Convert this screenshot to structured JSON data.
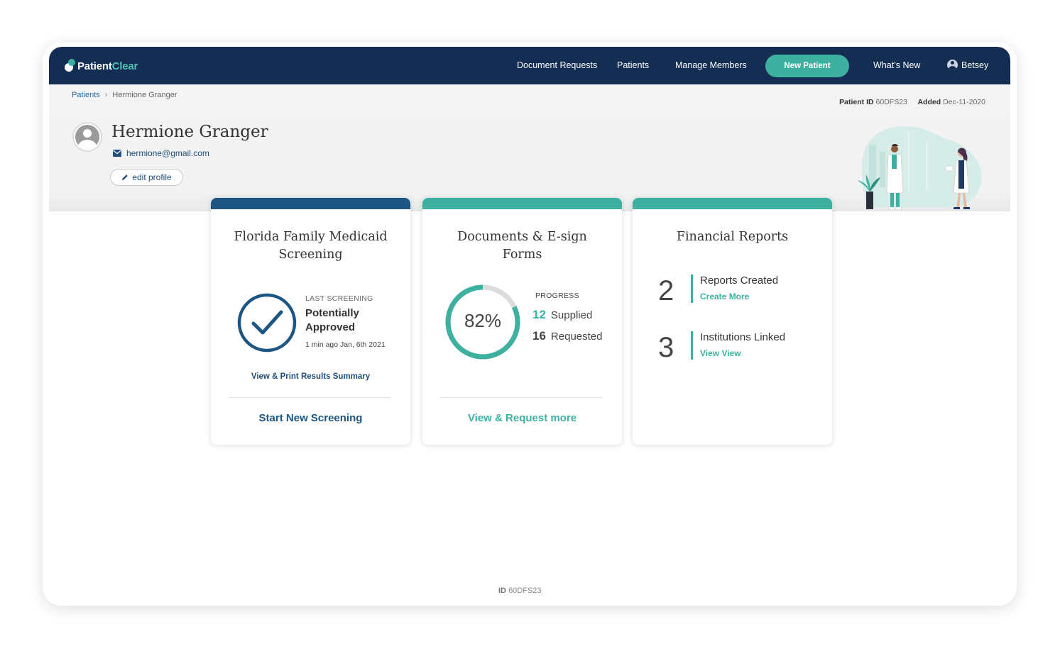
{
  "brand": {
    "name_part1": "Patient",
    "name_part2": "Clear"
  },
  "nav": {
    "links": [
      "Document Requests",
      "Patients",
      "Manage Members"
    ],
    "primary_button": "New Patient",
    "whats_new": "What’s New",
    "user_name": "Betsey"
  },
  "breadcrumb": {
    "parent": "Patients",
    "separator": ">",
    "current": "Hermione Granger"
  },
  "patient": {
    "id_label": "Patient ID",
    "id_value": "60DFS23",
    "added_label": "Added",
    "added_value": "Dec-11-2020",
    "name": "Hermione Granger",
    "email": "hermione@gmail.com",
    "edit_label": "edit profile"
  },
  "cards": {
    "screening": {
      "title": "Florida Family Medicaid Screening",
      "last_label": "LAST SCREENING",
      "status": "Potentially Approved",
      "time": "1 min ago Jan, 6th 2021",
      "print_link": "View  & Print Results Summary",
      "cta": "Start New Screening",
      "accent": "#1d5683"
    },
    "documents": {
      "title": "Documents & E-sign Forms",
      "progress_label": "PROGRESS",
      "percent_text": "82%",
      "percent_value": 82,
      "supplied_count": "12",
      "supplied_label": "Supplied",
      "requested_count": "16",
      "requested_label": "Requested",
      "cta": "View & Request more",
      "accent": "#3eb0a0"
    },
    "financial": {
      "title": "Financial Reports",
      "rows": [
        {
          "count": "2",
          "label": "Reports Created",
          "link": "Create  More"
        },
        {
          "count": "3",
          "label": "Institutions Linked",
          "link": "View View"
        }
      ],
      "accent": "#3eb0a0"
    }
  },
  "footer": {
    "id_label": "ID",
    "id_value": "60DFS23"
  },
  "colors": {
    "navy": "#142d52",
    "teal": "#3eb0a0",
    "blue": "#1d5683"
  },
  "icons": [
    "user-circle-icon",
    "envelope-icon",
    "pencil-icon",
    "checkmark-circle-icon",
    "avatar-placeholder-icon"
  ]
}
